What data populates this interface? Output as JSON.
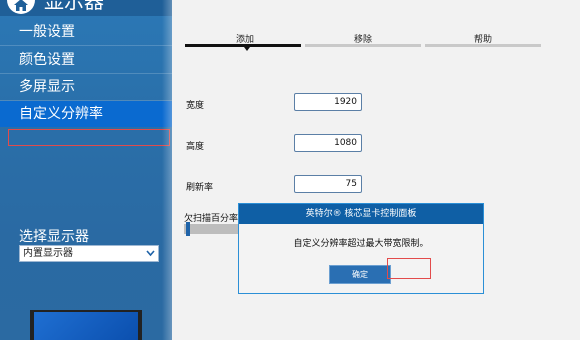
{
  "app": {
    "title": "显示器",
    "home_icon": "home-icon"
  },
  "sidebar": {
    "items": [
      {
        "label": "一般设置"
      },
      {
        "label": "颜色设置"
      },
      {
        "label": "多屏显示"
      },
      {
        "label": "自定义分辨率",
        "active": true
      }
    ],
    "select_label": "选择显示器",
    "select_value": "内置显示器"
  },
  "tabs": [
    {
      "label": "添加",
      "active": true
    },
    {
      "label": "移除"
    },
    {
      "label": "帮助"
    }
  ],
  "fields": {
    "width_label": "宽度",
    "width_value": "1920",
    "height_label": "高度",
    "height_value": "1080",
    "refresh_label": "刷新率",
    "refresh_value": "75",
    "overscan_label": "欠扫描百分率"
  },
  "dialog": {
    "title": "英特尔® 核芯显卡控制面板",
    "message": "自定义分辨率超过最大带宽限制。",
    "ok_label": "确定"
  },
  "colors": {
    "sidebar_blue": "#2a6fa9",
    "active_item": "#0a6ad0",
    "dialog_title": "#0f5fa5",
    "button_blue": "#2a6fb3",
    "highlight_red": "#e24b4b"
  }
}
